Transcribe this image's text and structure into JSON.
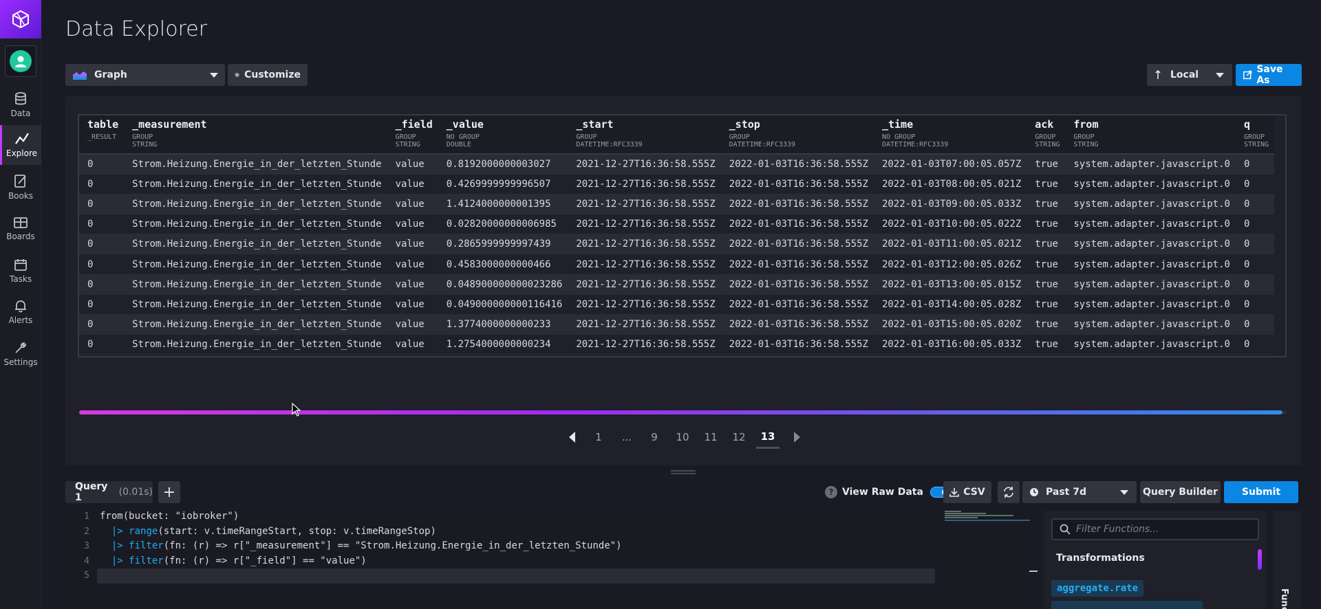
{
  "sidebar": {
    "items": [
      {
        "label": "Data",
        "icon": "database-icon"
      },
      {
        "label": "Explore",
        "icon": "explore-icon",
        "active": true
      },
      {
        "label": "Books",
        "icon": "notebook-icon"
      },
      {
        "label": "Boards",
        "icon": "dashboard-icon"
      },
      {
        "label": "Tasks",
        "icon": "calendar-icon"
      },
      {
        "label": "Alerts",
        "icon": "bell-icon"
      },
      {
        "label": "Settings",
        "icon": "wrench-icon"
      }
    ]
  },
  "header": {
    "title": "Data Explorer",
    "view_type": "Graph",
    "customize_label": "Customize",
    "timezone": "Local",
    "save_as_label": "Save As"
  },
  "table": {
    "columns": [
      {
        "name": "table",
        "group": "_RESULT",
        "type": ""
      },
      {
        "name": "_measurement",
        "group": "GROUP",
        "type": "STRING"
      },
      {
        "name": "_field",
        "group": "GROUP",
        "type": "STRING"
      },
      {
        "name": "_value",
        "group": "NO GROUP",
        "type": "DOUBLE"
      },
      {
        "name": "_start",
        "group": "GROUP",
        "type": "DATETIME:RFC3339"
      },
      {
        "name": "_stop",
        "group": "GROUP",
        "type": "DATETIME:RFC3339"
      },
      {
        "name": "_time",
        "group": "NO GROUP",
        "type": "DATETIME:RFC3339"
      },
      {
        "name": "ack",
        "group": "GROUP",
        "type": "STRING"
      },
      {
        "name": "from",
        "group": "GROUP",
        "type": "STRING"
      },
      {
        "name": "q",
        "group": "GROUP",
        "type": "STRING"
      }
    ],
    "rows": [
      [
        "0",
        "Strom.Heizung.Energie_in_der_letzten_Stunde",
        "value",
        "0.8192000000003027",
        "2021-12-27T16:36:58.555Z",
        "2022-01-03T16:36:58.555Z",
        "2022-01-03T07:00:05.057Z",
        "true",
        "system.adapter.javascript.0",
        "0"
      ],
      [
        "0",
        "Strom.Heizung.Energie_in_der_letzten_Stunde",
        "value",
        "0.4269999999996507",
        "2021-12-27T16:36:58.555Z",
        "2022-01-03T16:36:58.555Z",
        "2022-01-03T08:00:05.021Z",
        "true",
        "system.adapter.javascript.0",
        "0"
      ],
      [
        "0",
        "Strom.Heizung.Energie_in_der_letzten_Stunde",
        "value",
        "1.4124000000001395",
        "2021-12-27T16:36:58.555Z",
        "2022-01-03T16:36:58.555Z",
        "2022-01-03T09:00:05.033Z",
        "true",
        "system.adapter.javascript.0",
        "0"
      ],
      [
        "0",
        "Strom.Heizung.Energie_in_der_letzten_Stunde",
        "value",
        "0.02820000000006985",
        "2021-12-27T16:36:58.555Z",
        "2022-01-03T16:36:58.555Z",
        "2022-01-03T10:00:05.022Z",
        "true",
        "system.adapter.javascript.0",
        "0"
      ],
      [
        "0",
        "Strom.Heizung.Energie_in_der_letzten_Stunde",
        "value",
        "0.2865999999997439",
        "2021-12-27T16:36:58.555Z",
        "2022-01-03T16:36:58.555Z",
        "2022-01-03T11:00:05.021Z",
        "true",
        "system.adapter.javascript.0",
        "0"
      ],
      [
        "0",
        "Strom.Heizung.Energie_in_der_letzten_Stunde",
        "value",
        "0.4583000000000466",
        "2021-12-27T16:36:58.555Z",
        "2022-01-03T16:36:58.555Z",
        "2022-01-03T12:00:05.026Z",
        "true",
        "system.adapter.javascript.0",
        "0"
      ],
      [
        "0",
        "Strom.Heizung.Energie_in_der_letzten_Stunde",
        "value",
        "0.048900000000023286",
        "2021-12-27T16:36:58.555Z",
        "2022-01-03T16:36:58.555Z",
        "2022-01-03T13:00:05.015Z",
        "true",
        "system.adapter.javascript.0",
        "0"
      ],
      [
        "0",
        "Strom.Heizung.Energie_in_der_letzten_Stunde",
        "value",
        "0.049000000000116416",
        "2021-12-27T16:36:58.555Z",
        "2022-01-03T16:36:58.555Z",
        "2022-01-03T14:00:05.028Z",
        "true",
        "system.adapter.javascript.0",
        "0"
      ],
      [
        "0",
        "Strom.Heizung.Energie_in_der_letzten_Stunde",
        "value",
        "1.3774000000000233",
        "2021-12-27T16:36:58.555Z",
        "2022-01-03T16:36:58.555Z",
        "2022-01-03T15:00:05.020Z",
        "true",
        "system.adapter.javascript.0",
        "0"
      ],
      [
        "0",
        "Strom.Heizung.Energie_in_der_letzten_Stunde",
        "value",
        "1.2754000000000234",
        "2021-12-27T16:36:58.555Z",
        "2022-01-03T16:36:58.555Z",
        "2022-01-03T16:00:05.033Z",
        "true",
        "system.adapter.javascript.0",
        "0"
      ]
    ]
  },
  "pagination": {
    "pages": [
      "1",
      "...",
      "9",
      "10",
      "11",
      "12",
      "13"
    ],
    "current": "13"
  },
  "query": {
    "tab_name": "Query 1",
    "tab_time": "(0.01s)",
    "view_raw_label": "View Raw Data",
    "view_raw_enabled": true,
    "csv_label": "CSV",
    "time_range": "Past 7d",
    "builder_label": "Query Builder",
    "submit_label": "Submit",
    "line_numbers": [
      "1",
      "2",
      "3",
      "4",
      "5"
    ],
    "code": {
      "l1a": "from(bucket: ",
      "l1b": "\"iobroker\"",
      "l1c": ")",
      "l2a": "  |> ",
      "l2b": "range",
      "l2c": "(start: v.timeRangeStart, stop: v.timeRangeStop)",
      "l3a": "  |> ",
      "l3b": "filter",
      "l3c": "(fn: (r) => r[\"_measurement\"] == \"Strom.Heizung.Energie_in_der_letzten_Stunde\")",
      "l4a": "  |> ",
      "l4b": "filter",
      "l4c": "(fn: (r) => r[\"_field\"] == \"value\")"
    }
  },
  "functions": {
    "search_placeholder": "Filter Functions...",
    "section": "Transformations",
    "items": [
      "aggregate.rate"
    ],
    "side_label": "Func"
  },
  "colors": {
    "accent_purple": "#c23bff",
    "primary_blue": "#0b86e3",
    "teal_avatar": "#1fc9a0"
  }
}
